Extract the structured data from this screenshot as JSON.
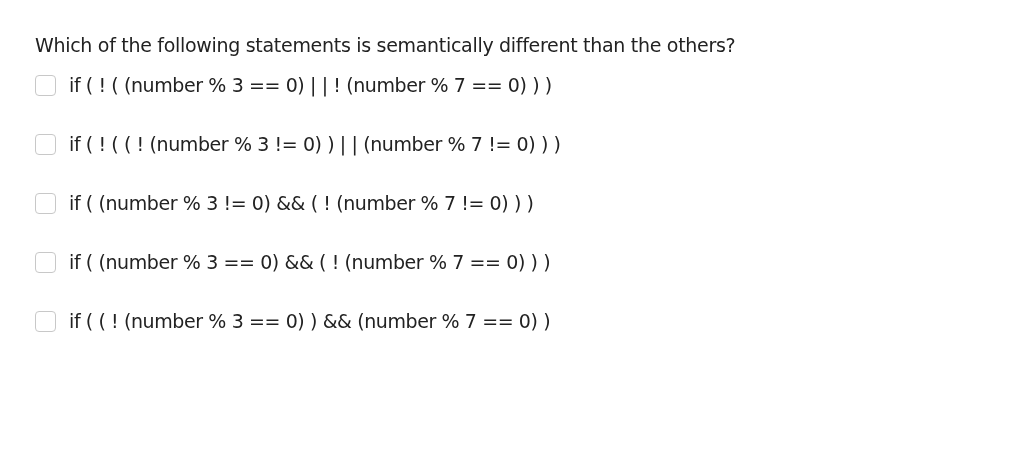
{
  "question": "Which of the following statements is semantically different than the others?",
  "options": [
    {
      "label": "if ( ! ( (number % 3 == 0) | | ! (number % 7 == 0) ) )",
      "checked": false
    },
    {
      "label": "if ( ! ( ( ! (number % 3 != 0) ) | | (number % 7 != 0) ) )",
      "checked": false
    },
    {
      "label": "if ( (number % 3 != 0) && ( ! (number % 7 != 0) ) )",
      "checked": false
    },
    {
      "label": "if ( (number % 3 == 0) && ( ! (number % 7 == 0) ) )",
      "checked": false
    },
    {
      "label": "if ( ( ! (number % 3 == 0) ) && (number % 7 == 0) )",
      "checked": false
    }
  ]
}
